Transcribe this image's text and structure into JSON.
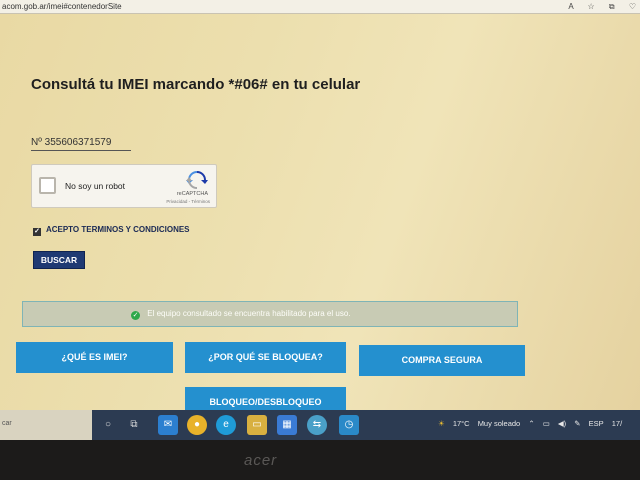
{
  "browser": {
    "url": "acom.gob.ar/imei#contenedorSite",
    "icons": [
      "A",
      "☆",
      "⧉",
      "♡"
    ]
  },
  "page": {
    "title": "Consultá tu IMEI marcando *#06# en tu celular",
    "imei_field": "Nº 355606371579",
    "captcha": {
      "label": "No soy un robot",
      "brand": "reCAPTCHA",
      "legal": "Privacidad - Términos"
    },
    "terms_label": "ACEPTO TERMINOS Y CONDICIONES",
    "search_button": "BUSCAR",
    "status_message": "El equipo consultado se encuentra habilitado para el uso.",
    "nav_buttons": [
      "¿QUÉ ES IMEI?",
      "¿POR QUÉ SE BLOQUEA?",
      "COMPRA SEGURA",
      "BLOQUEO/DESBLOQUEO"
    ]
  },
  "taskbar": {
    "search_text": "car",
    "weather": "17°C",
    "weather_desc": "Muy soleado",
    "language": "ESP",
    "time": "17/"
  },
  "monitor_brand": "acer",
  "colors": {
    "accent_blue": "#2490cf",
    "search_button_bg": "#1f3a73",
    "status_bg": "#c8cbb4",
    "taskbar_bg": "#2c3b52"
  }
}
